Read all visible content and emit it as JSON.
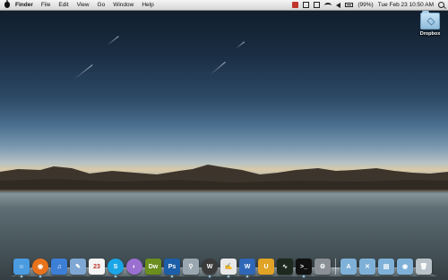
{
  "menubar": {
    "app_name": "Finder",
    "menus": [
      "File",
      "Edit",
      "View",
      "Go",
      "Window",
      "Help"
    ],
    "battery": "(99%)",
    "clock": "Tue Feb 23  10:50 AM"
  },
  "desktop": {
    "icons": [
      {
        "label": "Dropbox",
        "icon": "dropbox-folder-icon"
      }
    ]
  },
  "dock": {
    "apps": [
      {
        "name": "finder",
        "icon": "finder-icon",
        "color": "#4a9be0",
        "glyph": "☺"
      },
      {
        "name": "firefox",
        "icon": "firefox-icon",
        "color": "#e8731c",
        "glyph": "◉"
      },
      {
        "name": "itunes",
        "icon": "itunes-icon",
        "color": "#3d7fd6",
        "glyph": "♫"
      },
      {
        "name": "preview",
        "icon": "preview-icon",
        "color": "#7fa7d4",
        "glyph": "✎"
      },
      {
        "name": "ical",
        "icon": "calendar-icon",
        "color": "#f4f4f4",
        "glyph": "23"
      },
      {
        "name": "skype",
        "icon": "skype-icon",
        "color": "#1aa6e6",
        "glyph": "S"
      },
      {
        "name": "adium",
        "icon": "chat-icon",
        "color": "#9a6fd0",
        "glyph": "◐"
      },
      {
        "name": "dreamweaver",
        "icon": "dreamweaver-icon",
        "color": "#6b8e1f",
        "glyph": "Dw"
      },
      {
        "name": "photoshop",
        "icon": "photoshop-icon",
        "color": "#1c5fa8",
        "glyph": "Ps"
      },
      {
        "name": "microphone",
        "icon": "microphone-icon",
        "color": "#9aa7b0",
        "glyph": "⚲"
      },
      {
        "name": "wordpress",
        "icon": "wordpress-icon",
        "color": "#3a3a3a",
        "glyph": "W"
      },
      {
        "name": "textedit",
        "icon": "textedit-icon",
        "color": "#e8e8e8",
        "glyph": "✍"
      },
      {
        "name": "word",
        "icon": "word-icon",
        "color": "#2f67b8",
        "glyph": "W"
      },
      {
        "name": "transmit",
        "icon": "magnet-icon",
        "color": "#e0a325",
        "glyph": "U"
      },
      {
        "name": "activity-monitor",
        "icon": "activity-monitor-icon",
        "color": "#1d2a1d",
        "glyph": "∿"
      },
      {
        "name": "terminal",
        "icon": "terminal-icon",
        "color": "#111111",
        "glyph": ">_"
      },
      {
        "name": "system-preferences",
        "icon": "gear-icon",
        "color": "#8a9096",
        "glyph": "⚙"
      }
    ],
    "stacks": [
      {
        "name": "applications",
        "icon": "applications-folder-icon",
        "color": "#7fb1d8",
        "glyph": "A"
      },
      {
        "name": "utilities",
        "icon": "utilities-folder-icon",
        "color": "#7fb1d8",
        "glyph": "✕"
      },
      {
        "name": "documents",
        "icon": "documents-folder-icon",
        "color": "#7fb1d8",
        "glyph": "▤"
      },
      {
        "name": "downloads",
        "icon": "downloads-folder-icon",
        "color": "#7fb1d8",
        "glyph": "◉"
      },
      {
        "name": "trash",
        "icon": "trash-icon",
        "color": "#b8c2c8",
        "glyph": "🗑"
      }
    ]
  }
}
